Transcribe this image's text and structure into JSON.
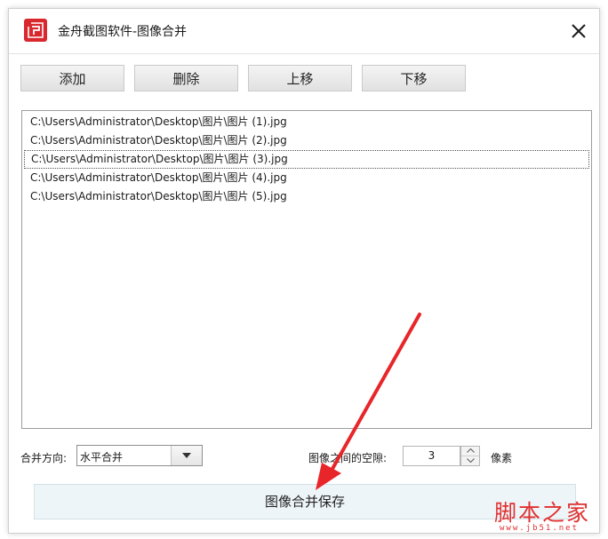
{
  "window": {
    "title": "金舟截图软件-图像合并"
  },
  "toolbar": {
    "add_label": "添加",
    "delete_label": "删除",
    "move_up_label": "上移",
    "move_down_label": "下移"
  },
  "files": [
    "C:\\Users\\Administrator\\Desktop\\图片\\图片 (1).jpg",
    "C:\\Users\\Administrator\\Desktop\\图片\\图片 (2).jpg",
    "C:\\Users\\Administrator\\Desktop\\图片\\图片 (3).jpg",
    "C:\\Users\\Administrator\\Desktop\\图片\\图片 (4).jpg",
    "C:\\Users\\Administrator\\Desktop\\图片\\图片 (5).jpg"
  ],
  "selected_file_index": 2,
  "merge": {
    "direction_label": "合并方向:",
    "direction_value": "水平合并",
    "gap_label": "图像之间的空隙:",
    "gap_value": "3",
    "gap_unit": "像素"
  },
  "save_label": "图像合并保存",
  "watermark": {
    "text": "脚本之家",
    "url": "www.jb51.net"
  },
  "colors": {
    "brand": "#d9272e",
    "annotation_arrow": "#e8262a",
    "save_button_bg": "#eef5f8"
  },
  "icons": {
    "app": "app-logo-icon",
    "close": "close-icon",
    "dropdown": "chevron-down-icon",
    "spin_up": "chevron-up-icon",
    "spin_down": "chevron-down-icon"
  }
}
